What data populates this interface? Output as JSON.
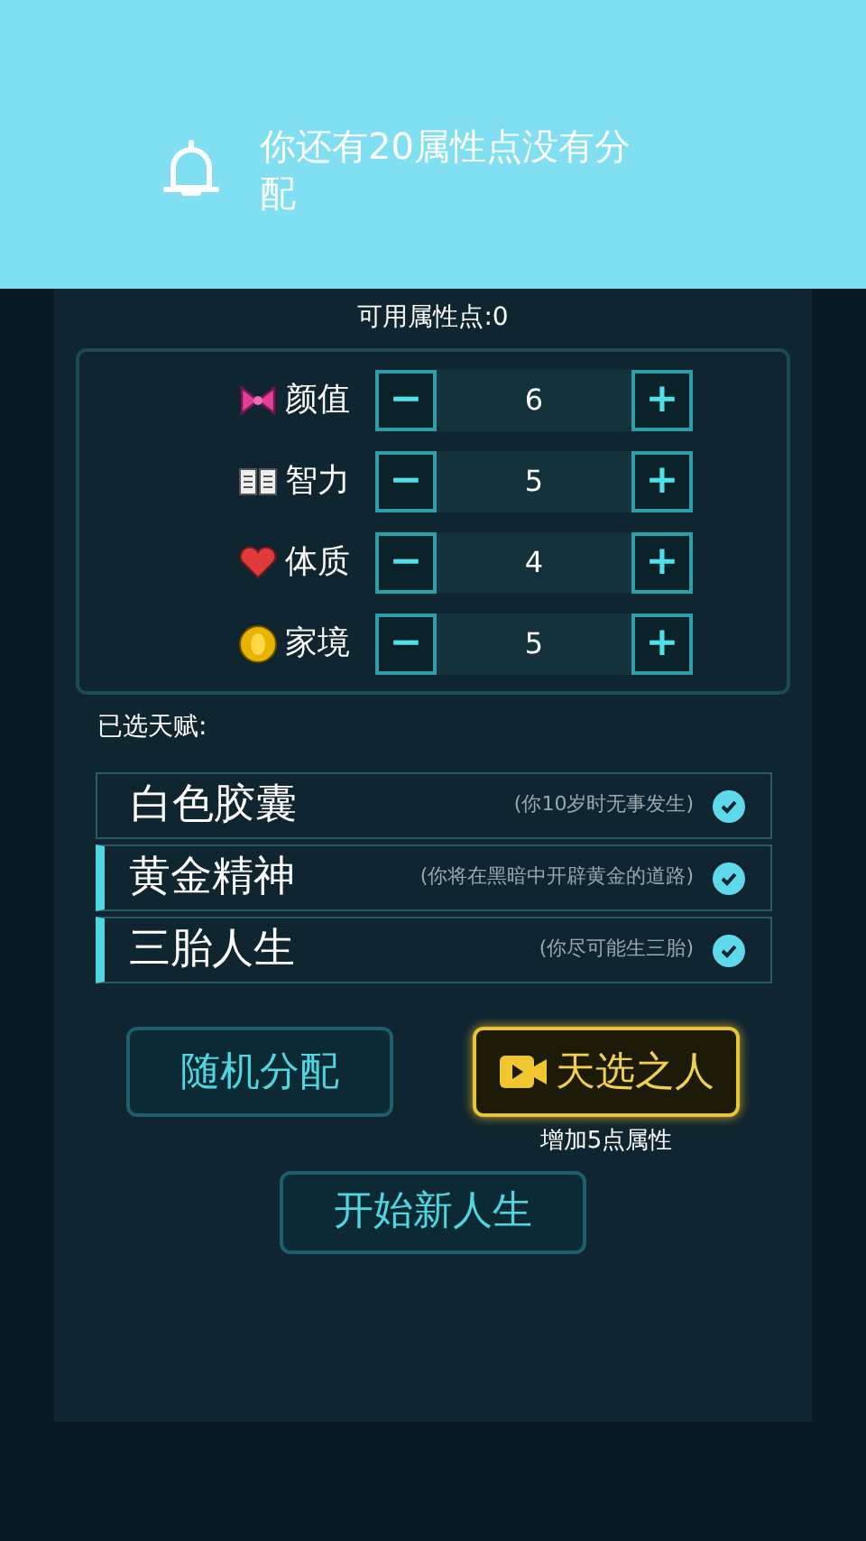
{
  "toast": {
    "message": "你还有20属性点没有分配"
  },
  "available_points": "可用属性点:0",
  "attributes": [
    {
      "kind": "bow",
      "label": "颜值",
      "value": "6",
      "minus": "−",
      "plus": "+"
    },
    {
      "kind": "book",
      "label": "智力",
      "value": "5",
      "minus": "−",
      "plus": "+"
    },
    {
      "kind": "heart",
      "label": "体质",
      "value": "4",
      "minus": "−",
      "plus": "+"
    },
    {
      "kind": "coin",
      "label": "家境",
      "value": "5",
      "minus": "−",
      "plus": "+"
    }
  ],
  "talents_heading": "已选天赋:",
  "talents": [
    {
      "name": "白色胶囊",
      "description": "(你10岁时无事发生)",
      "checked": true,
      "marked": false
    },
    {
      "name": "黄金精神",
      "description": "(你将在黑暗中开辟黄金的道路)",
      "checked": true,
      "marked": true
    },
    {
      "name": "三胎人生",
      "description": "(你尽可能生三胎)",
      "checked": true,
      "marked": true
    }
  ],
  "buttons": [
    {
      "kind": "cyan",
      "label": "随机分配"
    },
    {
      "kind": "gold",
      "label": "天选之人",
      "note": "增加5点属性"
    }
  ],
  "start_button": "开始新人生"
}
